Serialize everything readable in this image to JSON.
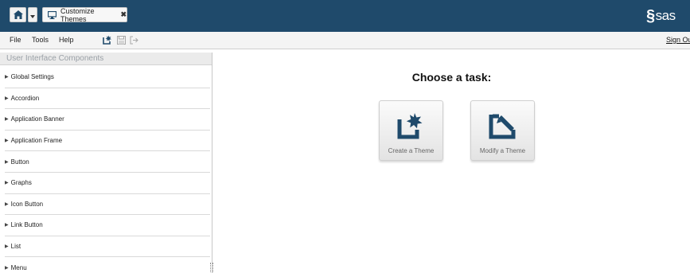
{
  "colors": {
    "banner": "#1f4a6b",
    "accent": "#1f4a6b"
  },
  "banner": {
    "home_icon": "home-icon",
    "app_tab": {
      "label": "Customize Themes",
      "icon": "monitor-icon",
      "close": "✖"
    },
    "logo_text": "sas"
  },
  "menubar": {
    "items": [
      "File",
      "Tools",
      "Help"
    ],
    "toolbar_icons": [
      "new-theme-icon",
      "save-icon",
      "export-icon"
    ],
    "signout": "Sign Out"
  },
  "panel": {
    "header": "User Interface Components",
    "items": [
      "Global Settings",
      "Accordion",
      "Application Banner",
      "Application Frame",
      "Button",
      "Graphs",
      "Icon Button",
      "Link Button",
      "List",
      "Menu"
    ]
  },
  "main": {
    "title": "Choose a task:",
    "tasks": [
      {
        "label": "Create a Theme",
        "icon": "create-theme-icon"
      },
      {
        "label": "Modify a Theme",
        "icon": "modify-theme-icon"
      }
    ]
  }
}
